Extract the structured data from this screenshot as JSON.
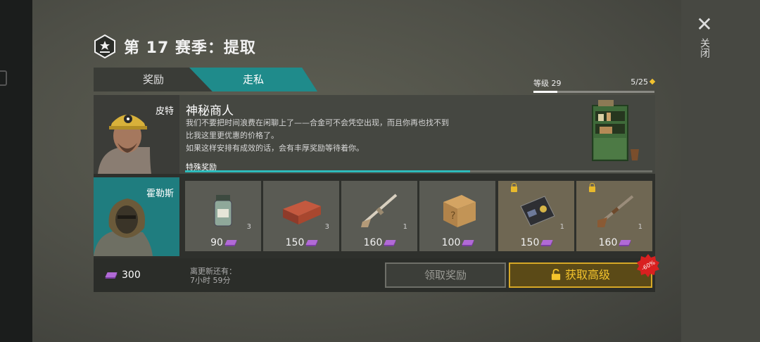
{
  "header": {
    "title": "第 17 赛季：提取"
  },
  "tabs": [
    {
      "label": "奖励",
      "active": false
    },
    {
      "label": "走私",
      "active": true
    }
  ],
  "close": {
    "label": "关闭"
  },
  "level": {
    "label": "等级 29",
    "progress_text": "5/25",
    "progress_fraction": 0.2
  },
  "characters": [
    {
      "name": "皮特"
    },
    {
      "name": "霍勒斯"
    }
  ],
  "dialog": {
    "title": "神秘商人",
    "lines": [
      "我们不要把时间浪费在闲聊上了——合金可不会凭空出现，而且你再也找不到",
      "比我这里更优惠的价格了。",
      "如果这样安排有成效的话，会有丰厚奖励等待着你。"
    ],
    "special_label": "特殊奖励",
    "special_progress_fraction": 0.61
  },
  "rewards": [
    {
      "item": "jar-icon",
      "qty": "3",
      "price": "90",
      "premium": false
    },
    {
      "item": "brick-icon",
      "qty": "3",
      "price": "150",
      "premium": false
    },
    {
      "item": "rifle-icon",
      "qty": "1",
      "price": "160",
      "premium": false
    },
    {
      "item": "crate-icon",
      "qty": "",
      "price": "100",
      "premium": false
    },
    {
      "item": "id-card-icon",
      "qty": "1",
      "price": "150",
      "premium": true
    },
    {
      "item": "shotgun-icon",
      "qty": "1",
      "price": "160",
      "premium": true
    }
  ],
  "footer": {
    "balance": "300",
    "refresh_label": "离更新还有：",
    "refresh_time": "7小时 59分",
    "claim_label": "领取奖励",
    "premium_label": "获取高级",
    "discount": "-60%"
  },
  "colors": {
    "accent": "#1f8b8b",
    "gold": "#d6a826",
    "ticket": "#b16ad6",
    "sale": "#d92020"
  }
}
